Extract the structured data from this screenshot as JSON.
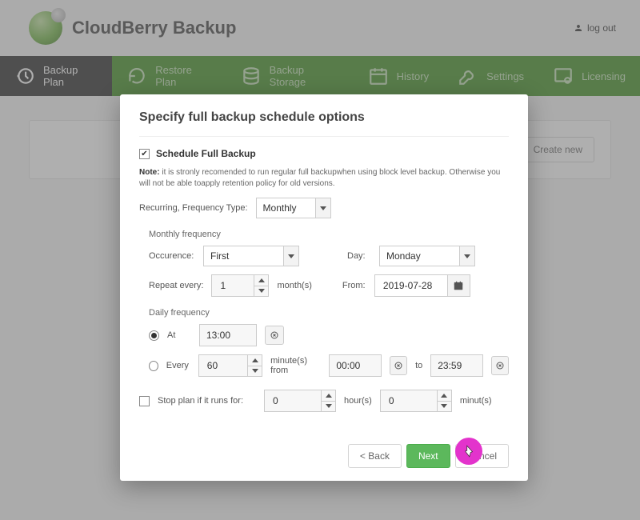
{
  "header": {
    "title": "CloudBerry Backup",
    "logout": "log out"
  },
  "nav": {
    "items": [
      {
        "label": "Backup Plan",
        "icon": "clock-restore-icon"
      },
      {
        "label": "Restore Plan",
        "icon": "restore-arrow-icon"
      },
      {
        "label": "Backup Storage",
        "icon": "storage-icon"
      },
      {
        "label": "History",
        "icon": "calendar-icon"
      },
      {
        "label": "Settings",
        "icon": "wrench-icon"
      },
      {
        "label": "Licensing",
        "icon": "license-icon"
      }
    ]
  },
  "page": {
    "create_new": "Create new"
  },
  "modal": {
    "title": "Specify full backup schedule options",
    "schedule_checkbox": "Schedule Full Backup",
    "note_prefix": "Note:",
    "note_text": " it is stronly recomended to run regular full backupwhen using block level backup. Otherwise you will not be able toapply retention policy for old versions.",
    "recurring_label": "Recurring, Frequency Type:",
    "recurring_value": "Monthly",
    "monthly_section": "Monthly frequency",
    "occurence_label": "Occurence:",
    "occurence_value": "First",
    "day_label": "Day:",
    "day_value": "Monday",
    "repeat_label": "Repeat every:",
    "repeat_value": "1",
    "repeat_unit": "month(s)",
    "from_label": "From:",
    "from_value": "2019-07-28",
    "daily_section": "Daily frequency",
    "at_label": "At",
    "at_value": "13:00",
    "every_label": "Every",
    "every_value": "60",
    "every_unit": "minute(s) from",
    "every_from": "00:00",
    "every_to_label": "to",
    "every_to": "23:59",
    "stop_label": "Stop plan if it runs for:",
    "stop_hours": "0",
    "stop_hours_unit": "hour(s)",
    "stop_minutes": "0",
    "stop_minutes_unit": "minut(s)",
    "btn_back": "< Back",
    "btn_next": "Next",
    "btn_cancel": "Cancel"
  }
}
